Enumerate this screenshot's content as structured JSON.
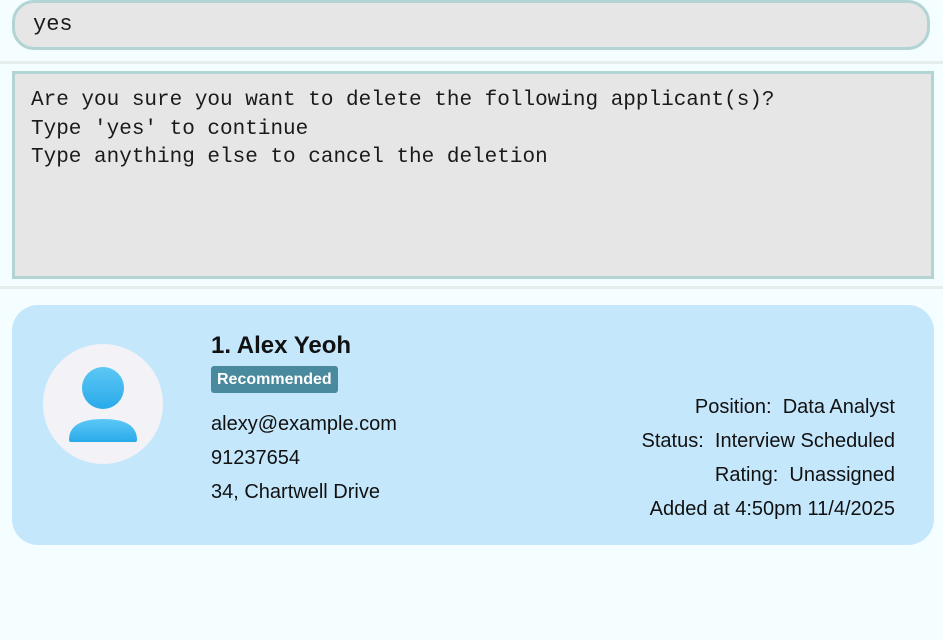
{
  "command_box": {
    "value": "yes"
  },
  "result_display": {
    "lines": [
      "Are you sure you want to delete the following applicant(s)?",
      "Type 'yes' to continue",
      "Type anything else to cancel the deletion"
    ]
  },
  "applicant_card": {
    "index_name": "1. Alex Yeoh",
    "tag": "Recommended",
    "email": "alexy@example.com",
    "phone": "91237654",
    "address": "34, Chartwell Drive",
    "position_label": "Position:",
    "position_value": "Data Analyst",
    "status_label": "Status:",
    "status_value": "Interview Scheduled",
    "rating_label": "Rating:",
    "rating_value": "Unassigned",
    "added_at": "Added at 4:50pm 11/4/2025",
    "avatar_icon": "person-icon"
  },
  "colors": {
    "card_background": "#c5e7fb",
    "tag_background": "#4a8a9e",
    "avatar_accent": "#3fb6ee"
  }
}
